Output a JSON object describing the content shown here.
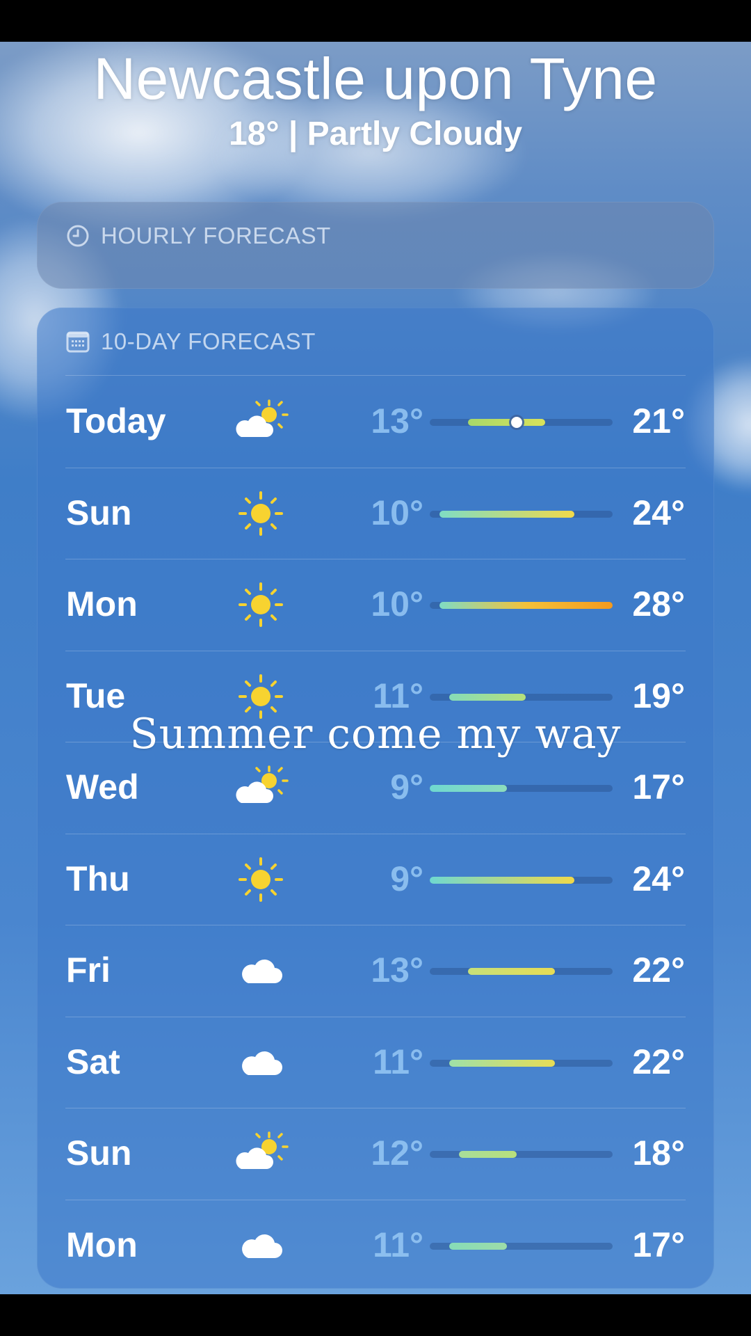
{
  "location": {
    "city": "Newcastle upon Tyne",
    "current_summary": "18°  |  Partly Cloudy"
  },
  "hourly": {
    "title": "HOURLY FORECAST",
    "icon": "clock-icon"
  },
  "tenday": {
    "title": "10-DAY FORECAST",
    "icon": "calendar-icon",
    "range_min": 9,
    "range_max": 28,
    "days": [
      {
        "day": "Today",
        "icon": "partly-cloudy-icon",
        "low": "13°",
        "high": "21°",
        "low_val": 13,
        "high_val": 21,
        "current_val": 18,
        "colors": [
          "#a7d86a",
          "#d9e25a"
        ]
      },
      {
        "day": "Sun",
        "icon": "sun-icon",
        "low": "10°",
        "high": "24°",
        "low_val": 10,
        "high_val": 24,
        "colors": [
          "#7fdcc4",
          "#f0d94a"
        ]
      },
      {
        "day": "Mon",
        "icon": "sun-icon",
        "low": "10°",
        "high": "28°",
        "low_val": 10,
        "high_val": 28,
        "colors": [
          "#7fdcc4",
          "#f3c13a",
          "#f39a1e"
        ]
      },
      {
        "day": "Tue",
        "icon": "sun-icon",
        "low": "11°",
        "high": "19°",
        "low_val": 11,
        "high_val": 19,
        "colors": [
          "#86dcb8",
          "#b6e07a"
        ]
      },
      {
        "day": "Wed",
        "icon": "partly-cloudy-icon",
        "low": "9°",
        "high": "17°",
        "low_val": 9,
        "high_val": 17,
        "colors": [
          "#6fd8d0",
          "#8ddcbc"
        ]
      },
      {
        "day": "Thu",
        "icon": "sun-icon",
        "low": "9°",
        "high": "24°",
        "low_val": 9,
        "high_val": 24,
        "colors": [
          "#6fd8d0",
          "#f0d94a"
        ]
      },
      {
        "day": "Fri",
        "icon": "cloud-icon",
        "low": "13°",
        "high": "22°",
        "low_val": 13,
        "high_val": 22,
        "colors": [
          "#c6e07a",
          "#e7dc55"
        ]
      },
      {
        "day": "Sat",
        "icon": "cloud-icon",
        "low": "11°",
        "high": "22°",
        "low_val": 11,
        "high_val": 22,
        "colors": [
          "#9ee0a8",
          "#e7dc55"
        ]
      },
      {
        "day": "Sun",
        "icon": "partly-cloudy-icon",
        "low": "12°",
        "high": "18°",
        "low_val": 12,
        "high_val": 18,
        "colors": [
          "#a8dd9a",
          "#b8e07c"
        ]
      },
      {
        "day": "Mon",
        "icon": "cloud-icon",
        "low": "11°",
        "high": "17°",
        "low_val": 11,
        "high_val": 17,
        "colors": [
          "#86dcb8",
          "#9ddca8"
        ]
      }
    ]
  },
  "overlay_caption": "Summer come my way",
  "colors": {
    "sun_yellow": "#f7d330",
    "cloud_white": "#ffffff",
    "low_temp_text": "#96c8f5"
  }
}
